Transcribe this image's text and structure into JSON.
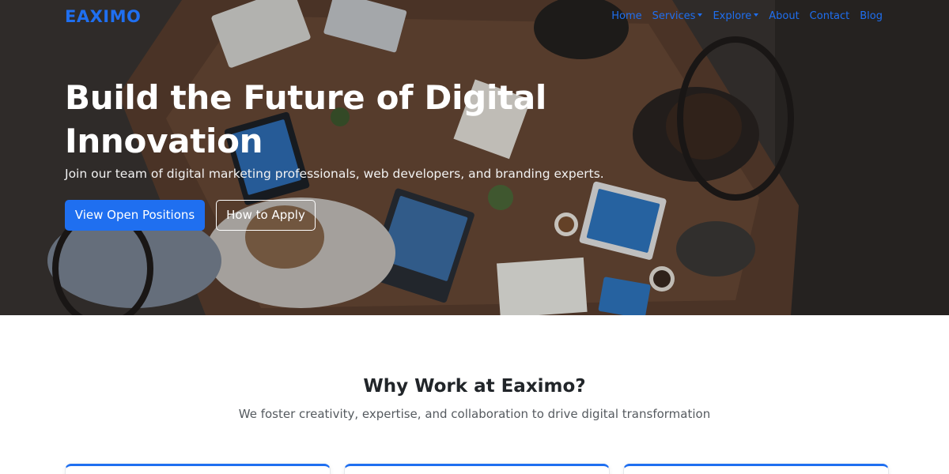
{
  "navbar": {
    "brand": "EAXIMO",
    "links": [
      {
        "label": "Home",
        "dropdown": false
      },
      {
        "label": "Services",
        "dropdown": true
      },
      {
        "label": "Explore",
        "dropdown": true
      },
      {
        "label": "About",
        "dropdown": false
      },
      {
        "label": "Contact",
        "dropdown": false
      },
      {
        "label": "Blog",
        "dropdown": false
      }
    ]
  },
  "hero": {
    "title": "Build the Future of Digital Innovation",
    "subtitle": "Join our team of digital marketing professionals, web developers, and branding experts.",
    "primary_button": "View Open Positions",
    "secondary_button": "How to Apply",
    "background": "team-meeting-photo"
  },
  "why": {
    "title": "Why Work at Eaximo?",
    "subtitle": "We foster creativity, expertise, and collaboration to drive digital transformation"
  },
  "colors": {
    "accent": "#1f6ff0",
    "hero_overlay": "#2b2623"
  }
}
